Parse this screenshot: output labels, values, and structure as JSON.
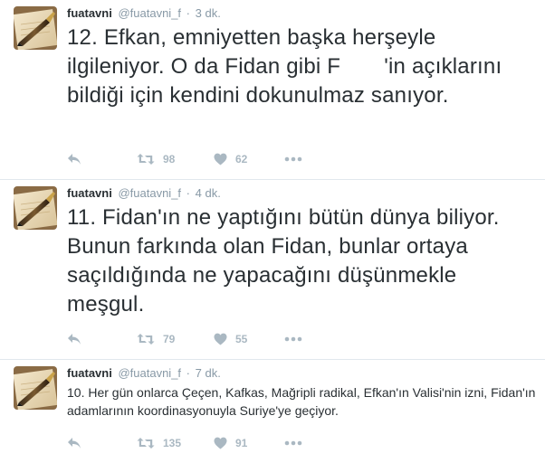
{
  "colors": {
    "text": "#292f33",
    "muted": "#8899a6",
    "icon": "#aab8c2",
    "divider": "#e1e8ed"
  },
  "tweets": [
    {
      "fullname": "fuatavni",
      "username": "@fuatavni_f",
      "separator": "·",
      "time": "3 dk.",
      "text": "12. Efkan, emniyetten başka herşeyle ilgileniyor. O da Fidan gibi F       'in açıklarını bildiği için kendini dokunulmaz sanıyor.",
      "retweets": "98",
      "likes": "62"
    },
    {
      "fullname": "fuatavni",
      "username": "@fuatavni_f",
      "separator": "·",
      "time": "4 dk.",
      "text": "11. Fidan'ın ne yaptığını bütün dünya biliyor. Bunun farkında olan Fidan, bunlar ortaya saçıldığında ne yapacağını düşünmekle meşgul.",
      "retweets": "79",
      "likes": "55"
    },
    {
      "fullname": "fuatavni",
      "username": "@fuatavni_f",
      "separator": "·",
      "time": "7 dk.",
      "text": "10. Her gün onlarca Çeçen, Kafkas, Mağripli radikal, Efkan'ın Valisi'nin izni, Fidan'ın adamlarının koordinasyonuyla Suriye'ye geçiyor.",
      "retweets": "135",
      "likes": "91"
    }
  ],
  "icons": {
    "reply": "reply-icon",
    "retweet": "retweet-icon",
    "like": "heart-icon",
    "more": "more-dots-icon",
    "avatar": "pen-on-paper-avatar"
  }
}
